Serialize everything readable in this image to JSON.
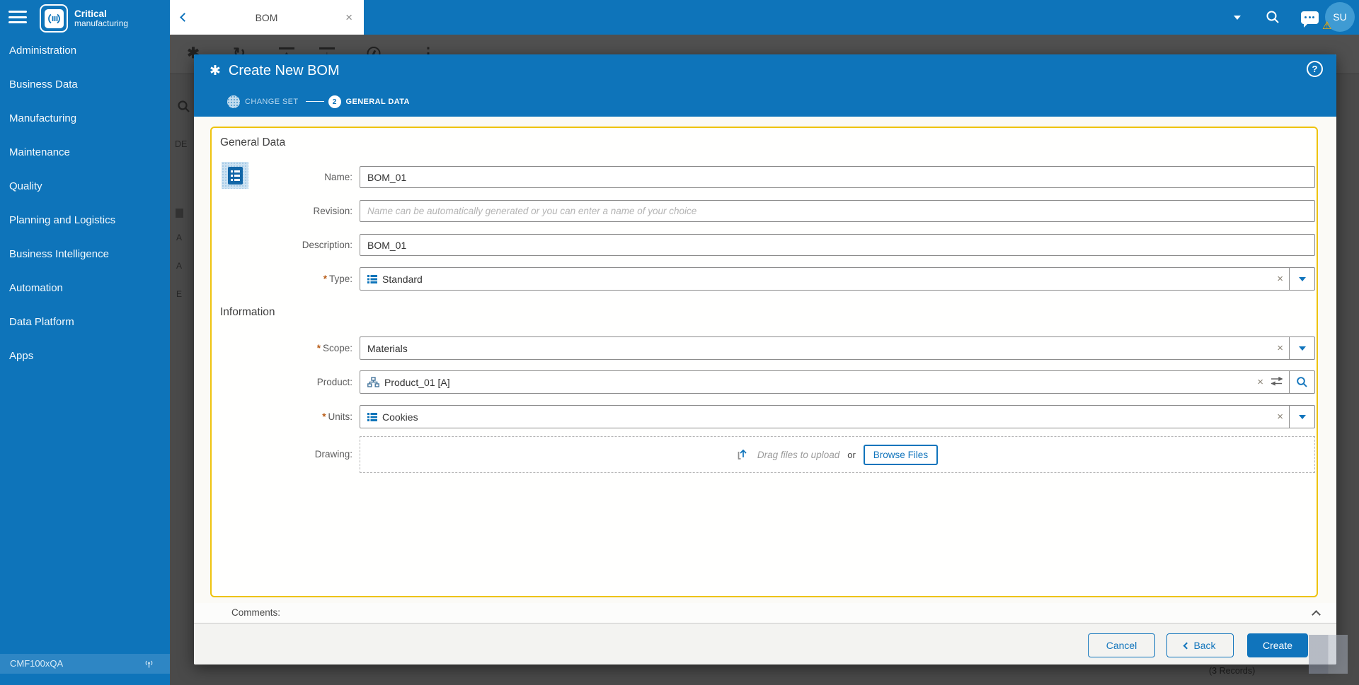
{
  "colors": {
    "brand_blue": "#0e74ba",
    "panel_border": "#eec30e",
    "required_orange": "#b85c16",
    "avatar_blue": "#3f9bd3"
  },
  "brand": {
    "line1": "Critical",
    "line2": "manufacturing"
  },
  "topbar": {
    "tab_label": "BOM",
    "avatar_initials": "SU"
  },
  "glyphs": {
    "close": "×",
    "clear": "×",
    "asterisk": "✱",
    "help": "?",
    "ellipsis": "⋮",
    "refresh": "↻",
    "arrow_up": "↑",
    "arrow_down": "↓",
    "warning": "⚠"
  },
  "sidebar": {
    "items": [
      "Administration",
      "Business Data",
      "Manufacturing",
      "Maintenance",
      "Quality",
      "Planning and Logistics",
      "Business Intelligence",
      "Automation",
      "Data Platform",
      "Apps"
    ],
    "status_label": "CMF100xQA"
  },
  "modal": {
    "title": "Create New BOM",
    "steps": {
      "step1_label": "CHANGE SET",
      "step2_num": "2",
      "step2_label": "GENERAL DATA"
    },
    "section_general": "General Data",
    "section_information": "Information",
    "required_marker": "*",
    "fields": {
      "name": {
        "label": "Name:",
        "value": "BOM_01"
      },
      "revision": {
        "label": "Revision:",
        "placeholder": "Name can be automatically generated or you can enter a name of your choice"
      },
      "description": {
        "label": "Description:",
        "value": "BOM_01"
      },
      "type": {
        "label": "Type:",
        "value": "Standard"
      },
      "scope": {
        "label": "Scope:",
        "value": "Materials"
      },
      "product": {
        "label": "Product:",
        "value": "Product_01 [A]"
      },
      "units": {
        "label": "Units:",
        "value": "Cookies"
      },
      "drawing": {
        "label": "Drawing:",
        "drag_text": "Drag files to upload",
        "or_text": "or",
        "browse_label": "Browse Files"
      }
    },
    "comments_label": "Comments:",
    "footer": {
      "cancel_label": "Cancel",
      "back_label": "Back",
      "create_label": "Create"
    }
  },
  "background": {
    "records_text": "(3 Records)",
    "partial_header": "DE",
    "partial_rows": [
      "A",
      "A",
      "E"
    ]
  }
}
